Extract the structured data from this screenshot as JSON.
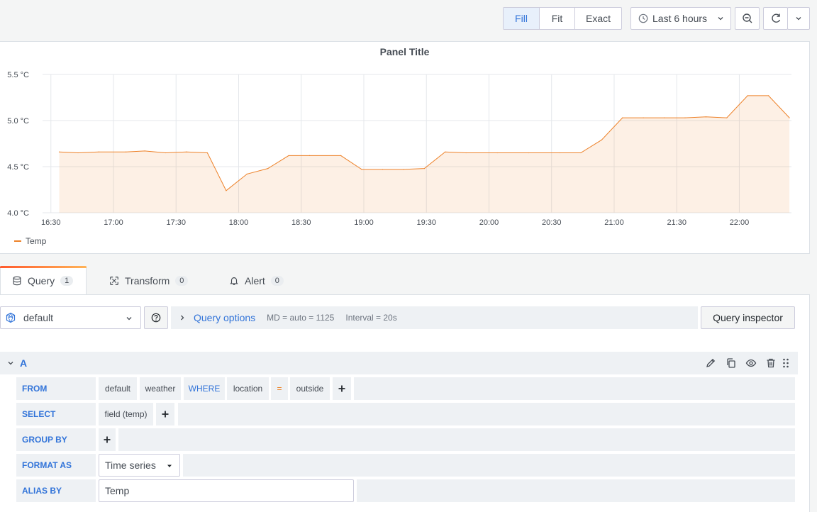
{
  "toolbar": {
    "fill_label": "Fill",
    "fit_label": "Fit",
    "exact_label": "Exact",
    "time_range": "Last 6 hours"
  },
  "panel": {
    "title": "Panel Title",
    "legend_label": "Temp"
  },
  "chart_data": {
    "type": "area",
    "title": "Panel Title",
    "xlabel": "",
    "ylabel": "",
    "ylim": [
      4.0,
      5.5
    ],
    "y_ticks": [
      "4.0 °C",
      "4.5 °C",
      "5.0 °C",
      "5.5 °C"
    ],
    "x_ticks": [
      "16:30",
      "17:00",
      "17:30",
      "18:00",
      "18:30",
      "19:00",
      "19:30",
      "20:00",
      "20:30",
      "21:00",
      "21:30",
      "22:00"
    ],
    "series": [
      {
        "name": "Temp",
        "color": "#ed8128",
        "x": [
          "16:34",
          "16:43",
          "16:53",
          "17:06",
          "17:15",
          "17:25",
          "17:35",
          "17:45",
          "17:54",
          "18:04",
          "18:14",
          "18:24",
          "18:34",
          "18:49",
          "18:59",
          "19:09",
          "19:19",
          "19:29",
          "19:39",
          "19:49",
          "20:04",
          "20:19",
          "20:34",
          "20:44",
          "20:54",
          "21:04",
          "21:14",
          "21:24",
          "21:34",
          "21:44",
          "21:54",
          "22:04",
          "22:14",
          "22:24"
        ],
        "values": [
          4.66,
          4.65,
          4.66,
          4.66,
          4.67,
          4.65,
          4.66,
          4.65,
          4.24,
          4.42,
          4.48,
          4.62,
          4.62,
          4.62,
          4.47,
          4.47,
          4.47,
          4.48,
          4.66,
          4.65,
          4.65,
          4.65,
          4.65,
          4.65,
          4.79,
          5.03,
          5.03,
          5.03,
          5.03,
          5.04,
          5.03,
          5.27,
          5.27,
          5.03
        ]
      }
    ]
  },
  "tabs": [
    {
      "label": "Query",
      "count": "1"
    },
    {
      "label": "Transform",
      "count": "0"
    },
    {
      "label": "Alert",
      "count": "0"
    }
  ],
  "datasource": {
    "name": "default"
  },
  "query_options": {
    "title": "Query options",
    "md": "MD = auto = 1125",
    "interval": "Interval = 20s"
  },
  "query_inspector_label": "Query inspector",
  "query": {
    "ref_id": "A",
    "from_label": "FROM",
    "from_db": "default",
    "from_measurement": "weather",
    "where_label": "WHERE",
    "where_key": "location",
    "where_op": "=",
    "where_value": "outside",
    "select_label": "SELECT",
    "select_field": "field (temp)",
    "groupby_label": "GROUP BY",
    "format_label": "FORMAT AS",
    "format_value": "Time series",
    "alias_label": "ALIAS BY",
    "alias_value": "Temp"
  },
  "colors": {
    "accent": "#3274d9",
    "series": "#ed8128"
  }
}
